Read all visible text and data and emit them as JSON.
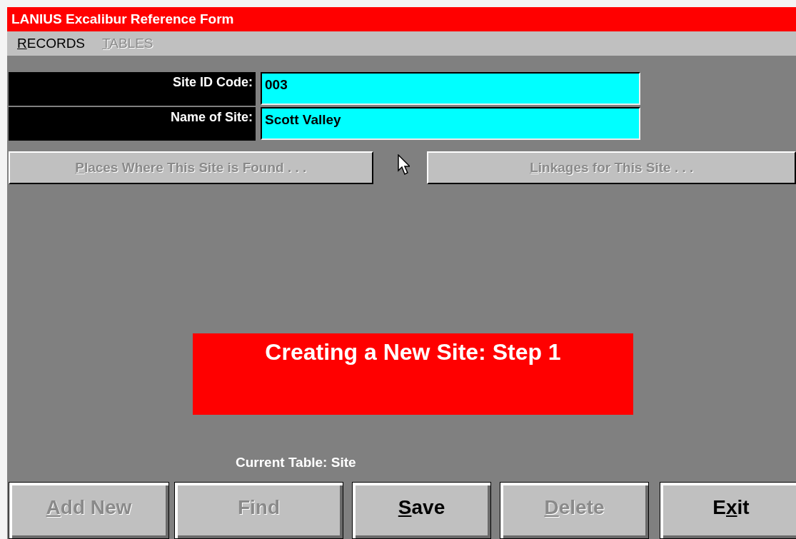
{
  "window": {
    "title": "LANIUS Excalibur Reference Form"
  },
  "menu": [
    {
      "key": "R",
      "after": "ECORDS",
      "disabled": false
    },
    {
      "key": "T",
      "after": "ABLES",
      "disabled": true
    }
  ],
  "fields": [
    {
      "label": "Site ID Code:",
      "value": "003"
    },
    {
      "label": "Name of Site:",
      "value": "Scott Valley"
    }
  ],
  "link_buttons": [
    {
      "key": "P",
      "after": "laces Where This Site is Found . . .",
      "disabled": true
    },
    {
      "key": "L",
      "after": "inkages for This Site . . .",
      "disabled": true
    }
  ],
  "banner": {
    "text": "Creating a New Site: Step 1"
  },
  "current_table": "Current Table:  Site",
  "buttons": [
    {
      "key": "A",
      "after": "dd New",
      "disabled": true
    },
    {
      "after": "Find",
      "disabled": true
    },
    {
      "key": "S",
      "after": "ave",
      "disabled": false
    },
    {
      "key": "D",
      "after": "elete",
      "disabled": true
    },
    {
      "before": "E",
      "key": "x",
      "after": "it",
      "disabled": false
    }
  ]
}
